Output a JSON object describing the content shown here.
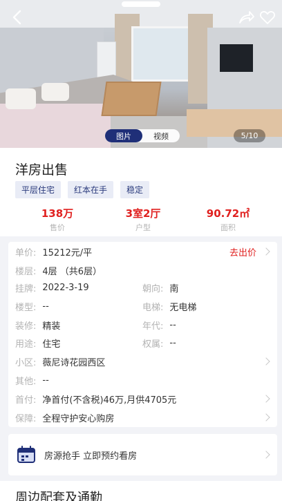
{
  "media": {
    "tabs": [
      "图片",
      "视频"
    ],
    "active_tab": 0,
    "counter": "5/10"
  },
  "icons": {
    "back": "chevron-left-icon",
    "share": "share-icon",
    "favorite": "heart-icon",
    "booking": "calendar-icon"
  },
  "listing": {
    "title": "洋房出售",
    "tags": [
      "平层住宅",
      "红本在手",
      "稳定"
    ],
    "stats": [
      {
        "value": "138万",
        "label": "售价"
      },
      {
        "value": "3室2厅",
        "label": "户型"
      },
      {
        "value": "90.72㎡",
        "label": "面积"
      }
    ]
  },
  "details": {
    "unit_price_label": "单价:",
    "unit_price": "15212元/平",
    "offer_label": "去出价",
    "floor_label": "楼层:",
    "floor": "4层 （共6层）",
    "listed_label": "挂牌:",
    "listed": "2022-3-19",
    "orientation_label": "朝向:",
    "orientation": "南",
    "building_type_label": "楼型:",
    "building_type": "--",
    "elevator_label": "电梯:",
    "elevator": "无电梯",
    "decoration_label": "装修:",
    "decoration": "精装",
    "year_label": "年代:",
    "year": "--",
    "usage_label": "用途:",
    "usage": "住宅",
    "ownership_label": "权属:",
    "ownership": "--",
    "community_label": "小区:",
    "community": "薇尼诗花园西区",
    "other_label": "其他:",
    "other": "--",
    "down_payment_label": "首付:",
    "down_payment": "净首付(不含税)46万,月供4705元",
    "guarantee_label": "保障:",
    "guarantee": "全程守护安心购房"
  },
  "booking": {
    "text": "房源抢手 立即预约看房"
  },
  "surroundings": {
    "title": "周边配套及通勤"
  },
  "colors": {
    "accent_red": "#e0201f",
    "navy": "#1f2f78",
    "tag_bg": "#e9ecf6"
  }
}
